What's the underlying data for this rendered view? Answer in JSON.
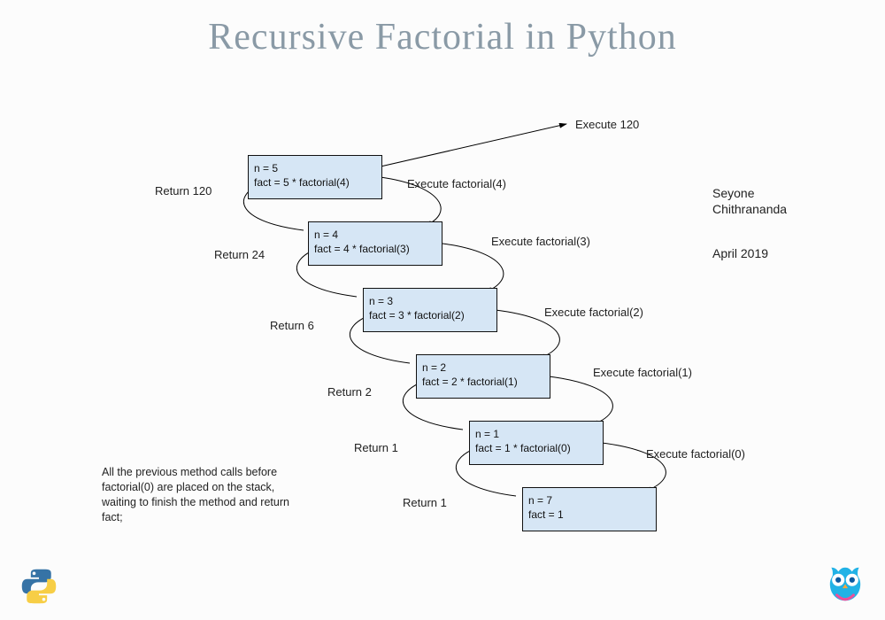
{
  "title": "Recursive Factorial in Python",
  "author_line1": "Seyone",
  "author_line2": "Chithrananda",
  "date": "April 2019",
  "note_text": "All the previous method calls before factorial(0) are placed on the stack, waiting to finish the method and return fact;",
  "top_execute": "Execute 120",
  "boxes": {
    "b5": {
      "l1": "n = 5",
      "l2": "fact = 5 * factorial(4)"
    },
    "b4": {
      "l1": "n = 4",
      "l2": "fact = 4 * factorial(3)"
    },
    "b3": {
      "l1": "n = 3",
      "l2": "fact = 3 * factorial(2)"
    },
    "b2": {
      "l1": "n = 2",
      "l2": "fact = 2 * factorial(1)"
    },
    "b1": {
      "l1": "n = 1",
      "l2": "fact = 1 * factorial(0)"
    },
    "b0": {
      "l1": "n = 7",
      "l2": "fact = 1"
    }
  },
  "exec_labels": {
    "e4": "Execute factorial(4)",
    "e3": "Execute factorial(3)",
    "e2": "Execute factorial(2)",
    "e1": "Execute factorial(1)",
    "e0": "Execute factorial(0)"
  },
  "return_labels": {
    "r120": "Return 120",
    "r24": "Return 24",
    "r6": "Return 6",
    "r2": "Return 2",
    "r1a": "Return 1",
    "r1b": "Return 1"
  }
}
